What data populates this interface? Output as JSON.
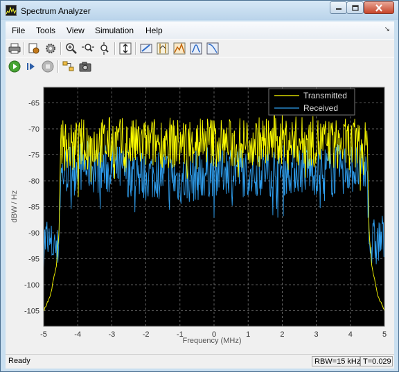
{
  "window": {
    "title": "Spectrum Analyzer"
  },
  "menu": {
    "items": [
      "File",
      "Tools",
      "View",
      "Simulation",
      "Help"
    ]
  },
  "toolbar1": {
    "icons": [
      "print-icon",
      "block-parameters-icon",
      "settings-icon",
      "zoom-in-icon",
      "zoom-x-icon",
      "zoom-y-icon",
      "autoscale-icon",
      "measurements-icon",
      "cursor-measurements-icon",
      "peak-finder-icon",
      "channel-measurements-icon",
      "distortion-measurements-icon"
    ]
  },
  "toolbar2": {
    "icons": [
      "run-icon",
      "step-forward-icon",
      "stop-icon",
      "highlight-block-icon",
      "snapshot-icon"
    ]
  },
  "status": {
    "ready": "Ready",
    "rbw": "RBW=15 kHz",
    "time": "T=0.029"
  },
  "colors": {
    "transmitted": "#ffff00",
    "received": "#2f9fef",
    "plot_bg": "#000000"
  },
  "chart_data": {
    "type": "line",
    "xlabel": "Frequency (MHz)",
    "ylabel": "dBW / Hz",
    "xlim": [
      -5,
      5
    ],
    "ylim": [
      -108,
      -62
    ],
    "xticks": [
      "-5",
      "-4",
      "-3",
      "-2",
      "-1",
      "0",
      "1",
      "2",
      "3",
      "4",
      "5"
    ],
    "yticks": [
      "-65",
      "-70",
      "-75",
      "-80",
      "-85",
      "-90",
      "-95",
      "-100",
      "-105"
    ],
    "grid": true,
    "legend_position": "top-right",
    "series": [
      {
        "name": "Transmitted",
        "color": "#ffff00",
        "x": [
          -5,
          -4.8,
          -4.62,
          -4.55,
          -4.52,
          -4.5,
          -4.4,
          -4.2,
          -4,
          -3.8,
          -3.5,
          -3,
          -2.5,
          -2,
          -1.5,
          -1,
          -0.5,
          0,
          0.5,
          1,
          1.5,
          2,
          2.5,
          3,
          3.5,
          4,
          4.2,
          4.4,
          4.5,
          4.52,
          4.55,
          4.62,
          4.8,
          5
        ],
        "y": [
          -105,
          -102,
          -96,
          -90,
          -80,
          -72,
          -73,
          -74,
          -73,
          -73,
          -73,
          -72.5,
          -73,
          -73,
          -72.5,
          -73,
          -72,
          -72.5,
          -73,
          -72.5,
          -72.5,
          -72,
          -72.5,
          -72.5,
          -73,
          -73,
          -73,
          -74,
          -73,
          -80,
          -90,
          -96,
          -102,
          -105
        ]
      },
      {
        "name": "Received",
        "color": "#2f9fef",
        "x": [
          -5,
          -4.9,
          -4.8,
          -4.7,
          -4.6,
          -4.55,
          -4.5,
          -4.4,
          -4,
          -3.5,
          -3,
          -2.5,
          -2,
          -1.5,
          -1,
          -0.5,
          0,
          0.5,
          1,
          1.5,
          2,
          2.5,
          3,
          3.5,
          4,
          4.4,
          4.5,
          4.55,
          4.6,
          4.7,
          4.8,
          4.9,
          5
        ],
        "y": [
          -92,
          -91,
          -93,
          -92,
          -94,
          -90,
          -79,
          -78,
          -77,
          -77.5,
          -78,
          -78,
          -79,
          -78.5,
          -80,
          -79,
          -78,
          -77.5,
          -78.5,
          -78,
          -78,
          -77.5,
          -78,
          -78,
          -77.5,
          -78,
          -79,
          -89,
          -93,
          -92,
          -92,
          -91,
          -92
        ]
      }
    ]
  }
}
